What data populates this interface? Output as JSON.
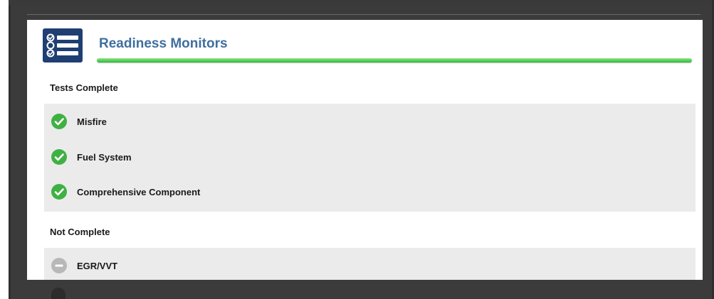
{
  "header": {
    "title": "Readiness Monitors",
    "icon": "checklist-icon",
    "accent_color": "#3f6f9f",
    "progress_color": "#2ebc35"
  },
  "sections": {
    "complete": {
      "heading": "Tests Complete",
      "items": [
        {
          "label": "Misfire",
          "status": "complete",
          "icon": "check-circle-icon"
        },
        {
          "label": "Fuel System",
          "status": "complete",
          "icon": "check-circle-icon"
        },
        {
          "label": "Comprehensive Component",
          "status": "complete",
          "icon": "check-circle-icon"
        }
      ]
    },
    "not_complete": {
      "heading": "Not Complete",
      "items": [
        {
          "label": "EGR/VVT",
          "status": "not-complete",
          "icon": "minus-circle-icon"
        }
      ]
    }
  }
}
